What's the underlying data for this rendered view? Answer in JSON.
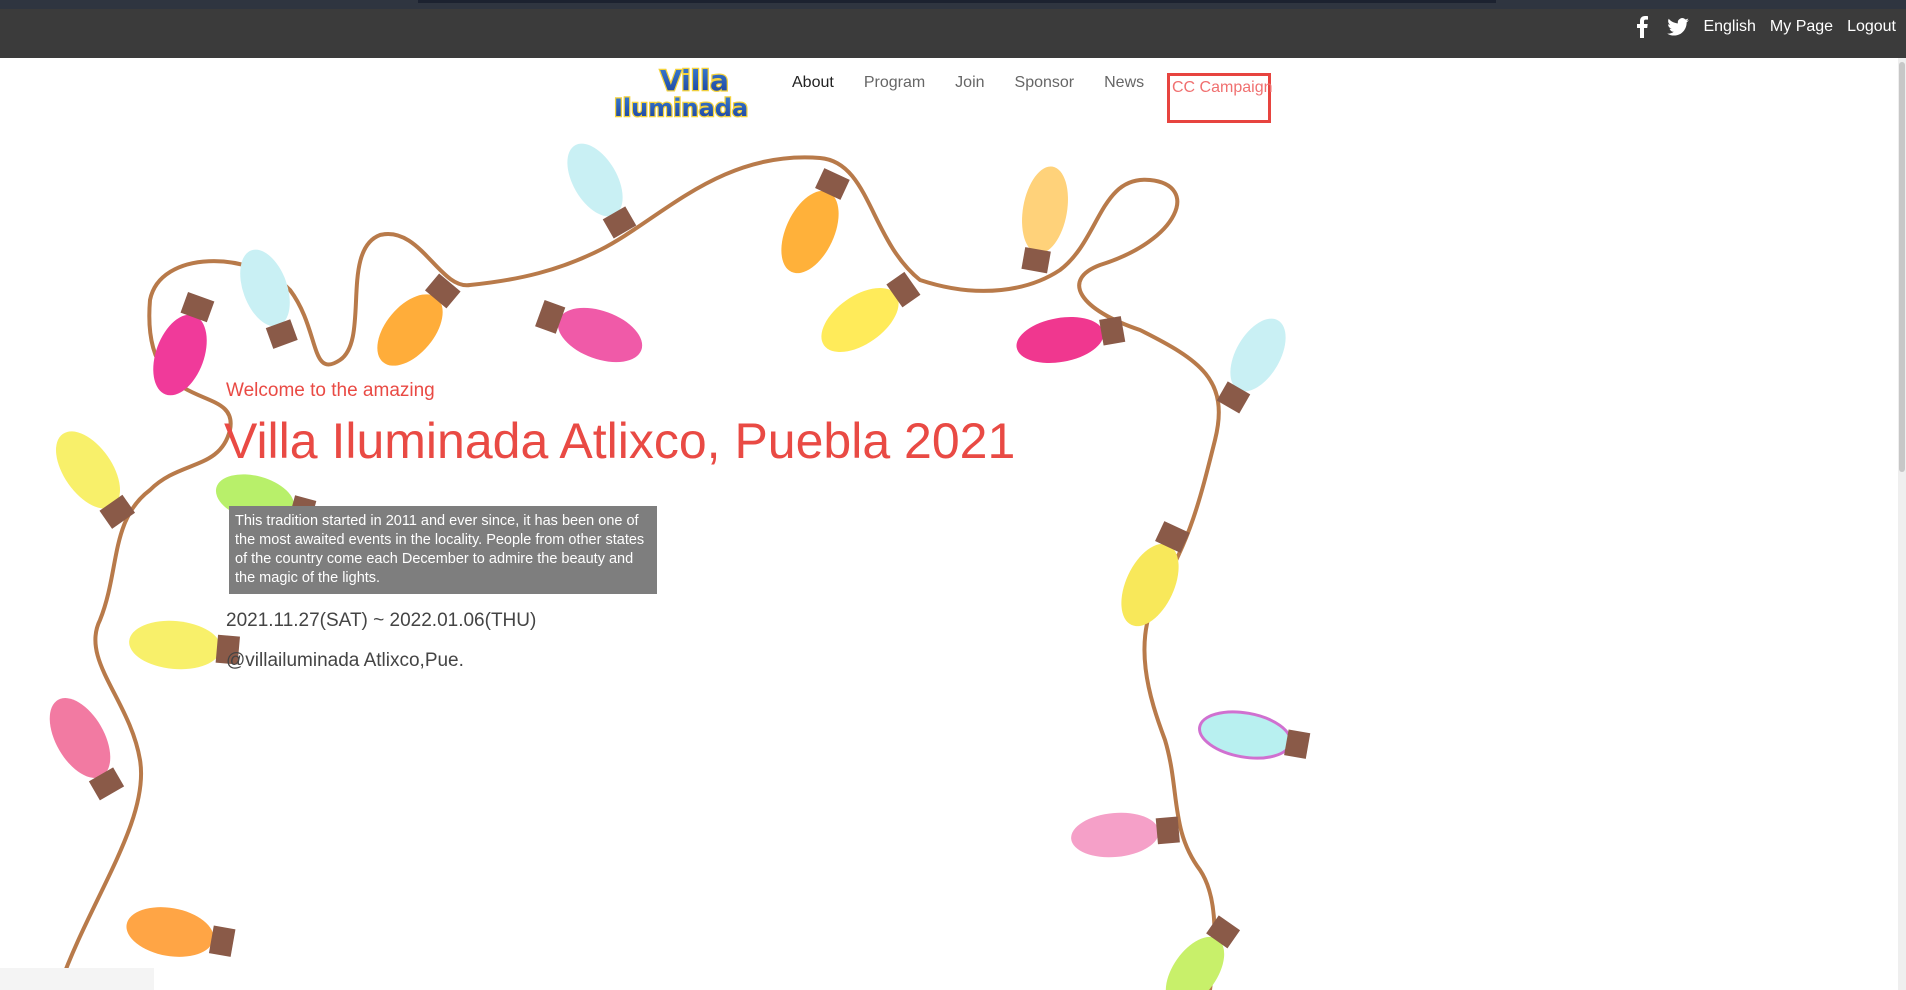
{
  "topbar": {
    "icons": [
      "facebook-icon",
      "twitter-icon"
    ],
    "links": {
      "language": "English",
      "mypage": "My Page",
      "logout": "Logout"
    }
  },
  "header": {
    "logo_text": {
      "line1": "Villa",
      "line2": "Iluminada"
    },
    "nav": {
      "about": "About",
      "program": "Program",
      "join": "Join",
      "sponsor": "Sponsor",
      "news": "News",
      "cc": "CC Campaign"
    }
  },
  "hero": {
    "welcome": "Welcome to the amazing",
    "title": "Villa Iluminada Atlixco, Puebla 2021",
    "description": "This tradition started in 2011 and ever since, it has been one of the most awaited events in the locality. People from other states of the country come each December to admire the beauty and the magic of the lights.",
    "dates": "2021.11.27(SAT) ~ 2022.01.06(THU)",
    "handle": "@villailuminada Atlixco,Pue."
  },
  "colors": {
    "accent": "#e94a44",
    "topbar": "#3b3b3b",
    "highlight_box": "#e7443f"
  }
}
